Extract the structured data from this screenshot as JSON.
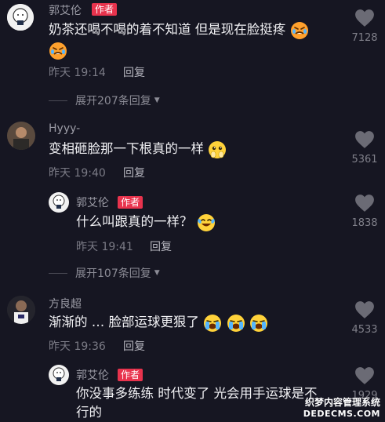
{
  "author_tag": "作者",
  "reply_label": "回复",
  "comments": [
    {
      "username": "郭艾伦",
      "text": "奶茶还喝不喝的着不知道 但是现在脸挺疼",
      "time": "昨天 19:14",
      "likes": "7128",
      "emoji": [
        "face-with-tears-hot",
        "face-with-tears-hot"
      ]
    },
    {
      "username": "Hyyy-",
      "text": "变相砸脸那一下根真的一样",
      "time": "昨天 19:40",
      "likes": "5361",
      "emoji": [
        "pleading-hands-face"
      ]
    },
    {
      "username": "郭艾伦",
      "text": "什么叫跟真的一样？",
      "time": "昨天 19:41",
      "likes": "1838",
      "emoji": [
        "tears-of-joy-face"
      ]
    },
    {
      "username": "方良超",
      "text": "渐渐的 … 脸部运球更狠了",
      "time": "昨天 19:36",
      "likes": "4533",
      "emoji": [
        "crying-face",
        "crying-face",
        "crying-face"
      ]
    },
    {
      "username": "郭艾伦",
      "text_line1": "你没事多练练 时代变了 光会用手运球是不",
      "text_line2": "行的",
      "likes": "1929"
    }
  ],
  "expand_1": "展开207条回复",
  "expand_2": "展开107条回复",
  "watermark": {
    "line1": "织梦内容管理系统",
    "line2": "DEDECMS.COM"
  },
  "colors": {
    "background": "#161622",
    "author_tag": "#e8334d",
    "heart": "#6b6b75"
  }
}
